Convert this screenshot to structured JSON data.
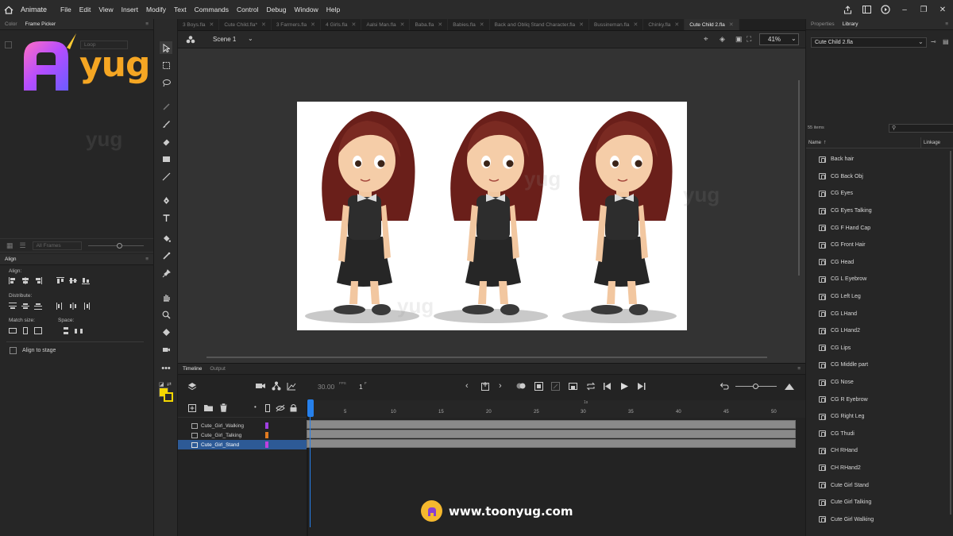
{
  "menubar": {
    "app_name": "Animate",
    "items": [
      "File",
      "Edit",
      "View",
      "Insert",
      "Modify",
      "Text",
      "Commands",
      "Control",
      "Debug",
      "Window",
      "Help"
    ]
  },
  "doc_tabs": [
    {
      "label": "3 Boys.fla",
      "active": false
    },
    {
      "label": "Cute Child.fla*",
      "active": false
    },
    {
      "label": "3 Farmers.fla",
      "active": false
    },
    {
      "label": "4 Girls.fla",
      "active": false
    },
    {
      "label": "Aalsi Man.fla",
      "active": false
    },
    {
      "label": "Baba.fla",
      "active": false
    },
    {
      "label": "Babies.fla",
      "active": false
    },
    {
      "label": "Back and Obliq Stand Character.fla",
      "active": false
    },
    {
      "label": "Bussineman.fla",
      "active": false
    },
    {
      "label": "Chinky.fla",
      "active": false
    },
    {
      "label": "Cute Child 2.fla",
      "active": true
    }
  ],
  "scene": {
    "label": "Scene 1",
    "zoom": "41%"
  },
  "left_panel": {
    "tabs": [
      "Color",
      "Frame Picker"
    ],
    "loop_label": "Loop",
    "all_frames": "All Frames",
    "align_title": "Align",
    "align_label": "Align:",
    "distribute_label": "Distribute:",
    "match_size_label": "Match size:",
    "space_label": "Space:",
    "align_to_stage": "Align to stage"
  },
  "right_panel": {
    "tabs": [
      "Properties",
      "Library"
    ],
    "doc_select": "Cute Child 2.fla",
    "items_count": "55 items",
    "col_name": "Name",
    "col_linkage": "Linkage",
    "items": [
      "Back hair",
      "CG Back Obj",
      "CG Eyes",
      "CG Eyes Talking",
      "CG F Hand Cap",
      "CG Front Hair",
      "CG Head",
      "CG L Eyebrow",
      "CG Left Leg",
      "CG LHand",
      "CG LHand2",
      "CG Lips",
      "CG Middle part",
      "CG Nose",
      "CG R Eyebrow",
      "CG Right Leg",
      "CG Thudi",
      "CH RHand",
      "CH RHand2",
      "Cute Girl Stand",
      "Cute Girl Talking",
      "Cute Girl Walking"
    ]
  },
  "timeline": {
    "tabs": [
      "Timeline",
      "Output"
    ],
    "fps": "30.00",
    "fps_unit": "FPS",
    "frame": "1",
    "frame_unit": "F",
    "second_marker": "1s",
    "ruler": [
      "5",
      "10",
      "15",
      "20",
      "25",
      "30",
      "35",
      "40",
      "45",
      "50"
    ],
    "layers": [
      {
        "name": "Cute_Girl_Walking",
        "color": "#a040e0",
        "selected": false
      },
      {
        "name": "Cute_Girl_Talking",
        "color": "#e07a20",
        "selected": false
      },
      {
        "name": "Cute_Girl_Stand",
        "color": "#c040e0",
        "selected": true
      }
    ]
  },
  "logo": {
    "text": "yug"
  },
  "footer": {
    "url": "www.toonyug.com"
  },
  "colors": {
    "accent": "#2680eb",
    "stroke_swatch": "#f5d800",
    "fill_swatch": "#f5d800"
  }
}
